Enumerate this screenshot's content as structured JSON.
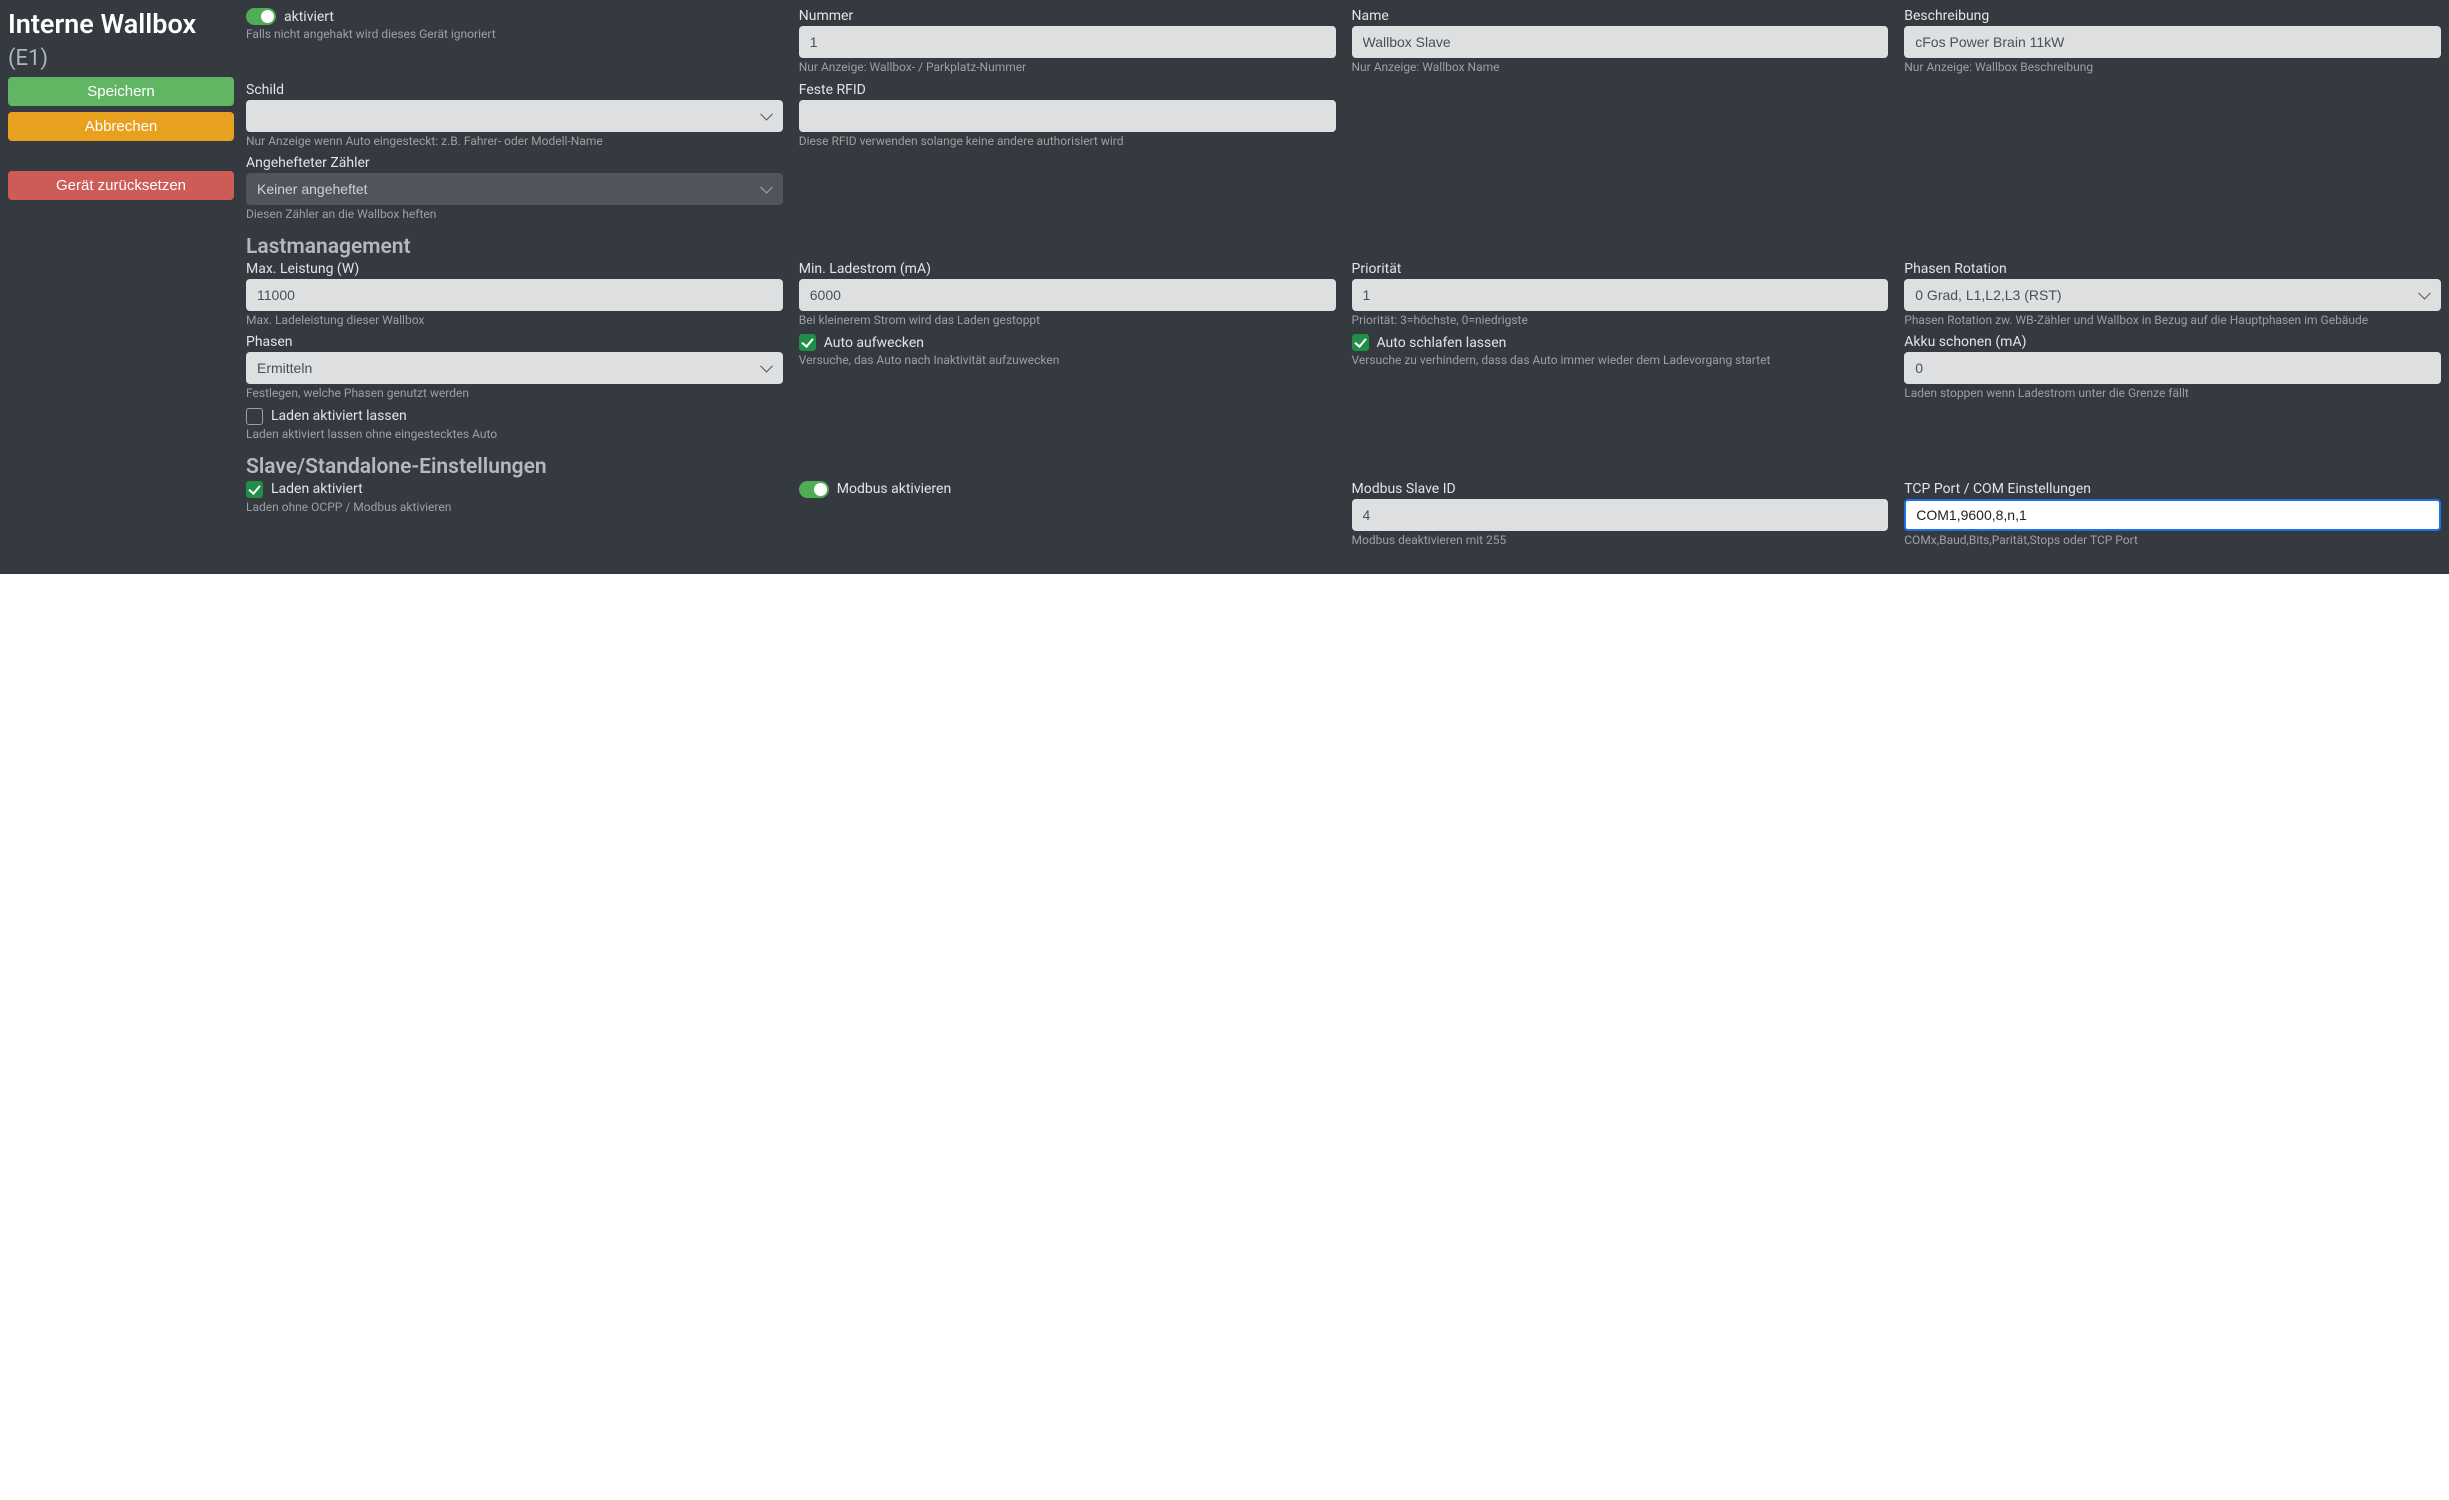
{
  "header": {
    "title": "Interne Wallbox",
    "subtitle": "(E1)"
  },
  "sidebar": {
    "save_label": "Speichern",
    "cancel_label": "Abbrechen",
    "reset_label": "Gerät zurücksetzen"
  },
  "general": {
    "activated_label": "aktiviert",
    "activated_help": "Falls nicht angehakt wird dieses Gerät ignoriert",
    "number_label": "Nummer",
    "number_value": "1",
    "number_help": "Nur Anzeige: Wallbox- / Parkplatz-Nummer",
    "name_label": "Name",
    "name_value": "Wallbox Slave",
    "name_help": "Nur Anzeige: Wallbox Name",
    "desc_label": "Beschreibung",
    "desc_value": "cFos Power Brain 11kW",
    "desc_help": "Nur Anzeige: Wallbox Beschreibung",
    "shield_label": "Schild",
    "shield_value": "",
    "shield_help": "Nur Anzeige wenn Auto eingesteckt: z.B. Fahrer- oder Modell-Name",
    "rfid_label": "Feste RFID",
    "rfid_value": "",
    "rfid_help": "Diese RFID verwenden solange keine andere authorisiert wird",
    "meter_label": "Angehefteter Zähler",
    "meter_value": "Keiner angeheftet",
    "meter_help": "Diesen Zähler an die Wallbox heften"
  },
  "load": {
    "heading": "Lastmanagement",
    "maxpower_label": "Max. Leistung (W)",
    "maxpower_value": "11000",
    "maxpower_help": "Max. Ladeleistung dieser Wallbox",
    "mincurrent_label": "Min. Ladestrom (mA)",
    "mincurrent_value": "6000",
    "mincurrent_help": "Bei kleinerem Strom wird das Laden gestoppt",
    "priority_label": "Priorität",
    "priority_value": "1",
    "priority_help": "Priorität: 3=höchste, 0=niedrigste",
    "rotation_label": "Phasen Rotation",
    "rotation_value": "0 Grad, L1,L2,L3 (RST)",
    "rotation_help": "Phasen Rotation zw. WB-Zähler und Wallbox in Bezug auf die Hauptphasen im Gebäude",
    "phases_label": "Phasen",
    "phases_value": "Ermitteln",
    "phases_help": "Festlegen, welche Phasen genutzt werden",
    "wake_label": "Auto aufwecken",
    "wake_help": "Versuche, das Auto nach Inaktivität aufzuwecken",
    "sleep_label": "Auto schlafen lassen",
    "sleep_help": "Versuche zu verhindern, dass das Auto immer wieder dem Ladevorgang startet",
    "battery_label": "Akku schonen (mA)",
    "battery_value": "0",
    "battery_help": "Laden stoppen wenn Ladestrom unter die Grenze fällt",
    "keepcharge_label": "Laden aktiviert lassen",
    "keepcharge_help": "Laden aktiviert lassen ohne eingestecktes Auto"
  },
  "slave": {
    "heading": "Slave/Standalone-Einstellungen",
    "charge_on_label": "Laden aktiviert",
    "charge_on_help": "Laden ohne OCPP / Modbus aktivieren",
    "modbus_on_label": "Modbus aktivieren",
    "slaveid_label": "Modbus Slave ID",
    "slaveid_value": "4",
    "slaveid_help": "Modbus deaktivieren mit 255",
    "tcp_label": "TCP Port / COM Einstellungen",
    "tcp_value": "COM1,9600,8,n,1",
    "tcp_help": "COMx,Baud,Bits,Parität,Stops oder TCP Port"
  }
}
